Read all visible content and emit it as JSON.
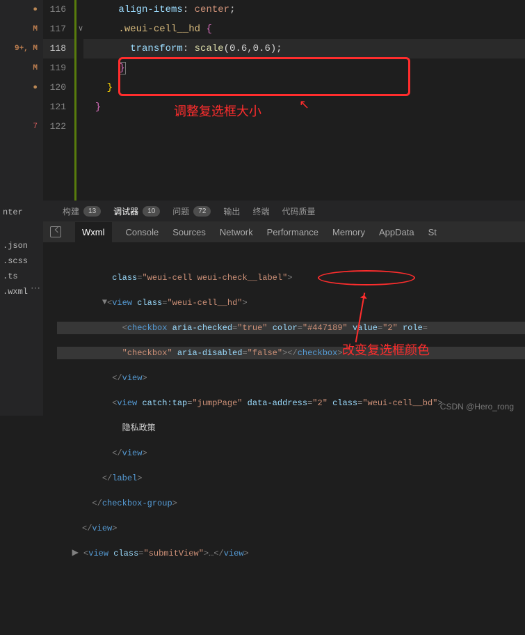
{
  "gutter": {
    "r1": "●",
    "r2": "M",
    "r3": "9+, M",
    "r4": "M",
    "r5": "●",
    "r6": "7"
  },
  "lineNumbers": [
    "116",
    "117",
    "118",
    "119",
    "120",
    "121",
    "122"
  ],
  "code": {
    "l116": {
      "prop": "align-items",
      "val": "center"
    },
    "l117": {
      "sel": ".weui-cell__hd",
      "brace": "{"
    },
    "l118": {
      "prop": "transform",
      "func": "scale",
      "args": "(0.6,0.6)"
    },
    "l119": {
      "brace": "}"
    },
    "l120": {
      "brace": "}"
    },
    "l121": {
      "brace": "}"
    }
  },
  "annotation1": "调整复选框大小",
  "panelTabs": {
    "build": {
      "label": "构建",
      "count": "13"
    },
    "debugger": {
      "label": "调试器",
      "count": "10"
    },
    "problems": {
      "label": "问题",
      "count": "72"
    },
    "output": "输出",
    "terminal": "终端",
    "codeQuality": "代码质量"
  },
  "sidebarFiles": {
    "f1": "nter",
    "f2": ".json",
    "f3": ".scss",
    "f4": ".ts",
    "f5": ".wxml"
  },
  "devTabs": {
    "wxml": "Wxml",
    "console": "Console",
    "sources": "Sources",
    "network": "Network",
    "performance": "Performance",
    "memory": "Memory",
    "appdata": "AppData",
    "more": "St"
  },
  "dom": {
    "l1_attr": "class",
    "l1_val": "weui-cell weui-check__label",
    "l2_tag": "view",
    "l2_attr": "class",
    "l2_val": "weui-cell__hd",
    "l3_tag": "checkbox",
    "l3_a1n": "aria-checked",
    "l3_a1v": "true",
    "l3_a2n": "color",
    "l3_a2v": "#447189",
    "l3_a3n": "value",
    "l3_a3v": "2",
    "l3_a4n": "role",
    "l4_a1v": "checkbox",
    "l4_a2n": "aria-disabled",
    "l4_a2v": "false",
    "l4_close": "checkbox",
    "l5_close": "view",
    "l6_tag": "view",
    "l6_a1n": "catch:tap",
    "l6_a1v": "jumpPage",
    "l6_a2n": "data-address",
    "l6_a2v": "2",
    "l6_a3n": "class",
    "l6_a3v": "weui-cell__bd",
    "l7_text": "隐私政策",
    "l8_close": "view",
    "l9_close": "label",
    "l10_close": "checkbox-group",
    "l11_close": "view",
    "l12_tag": "view",
    "l12_an": "class",
    "l12_av": "submitView",
    "l12_dots": "…",
    "l12_close": "view"
  },
  "annotation2": "改变复选框颜色",
  "watermark": "CSDN @Hero_rong"
}
